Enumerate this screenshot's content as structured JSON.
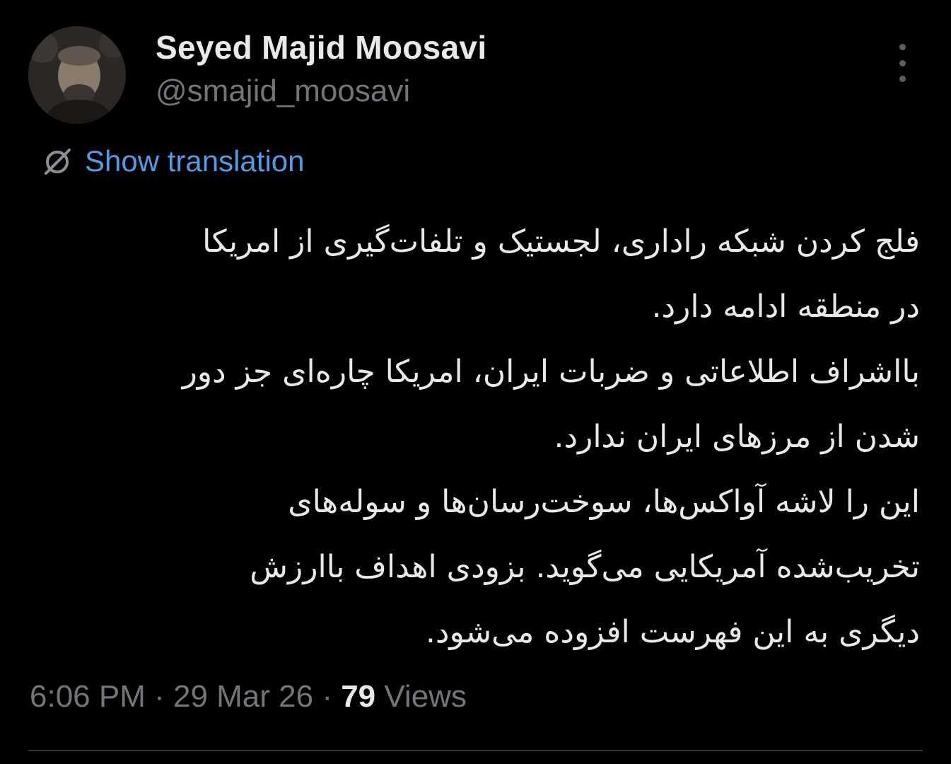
{
  "author": {
    "display_name": "Seyed Majid Moosavi",
    "handle": "@smajid_moosavi"
  },
  "actions": {
    "more_icon": "more-vertical-icon"
  },
  "translation": {
    "icon": "globe-slash-icon",
    "label": "Show translation"
  },
  "post": {
    "lines": [
      "فلج کردن شبکه راداری، لجستیک و تلفات‌گیری از امریکا",
      "در منطقه ادامه دارد.",
      "بااشراف اطلاعاتی و ضربات ایران، امریکا چاره‌ای جز دور",
      "شدن از مرزهای ایران ندارد.",
      "این را لاشه آواکس‌ها، سوخت‌رسان‌ها و سوله‌های",
      "تخریب‌شده آمریکایی می‌گوید. بزودی اهداف باارزش",
      "دیگری به این فهرست افزوده می‌شود."
    ]
  },
  "meta": {
    "time": "6:06 PM",
    "separator": " · ",
    "date": "29 Mar 26",
    "views_count": "79",
    "views_label": " Views"
  },
  "colors": {
    "background": "#000000",
    "text": "#e7e9ea",
    "secondary": "#71767b",
    "link": "#4d9ee6",
    "divider": "#2f3336"
  }
}
